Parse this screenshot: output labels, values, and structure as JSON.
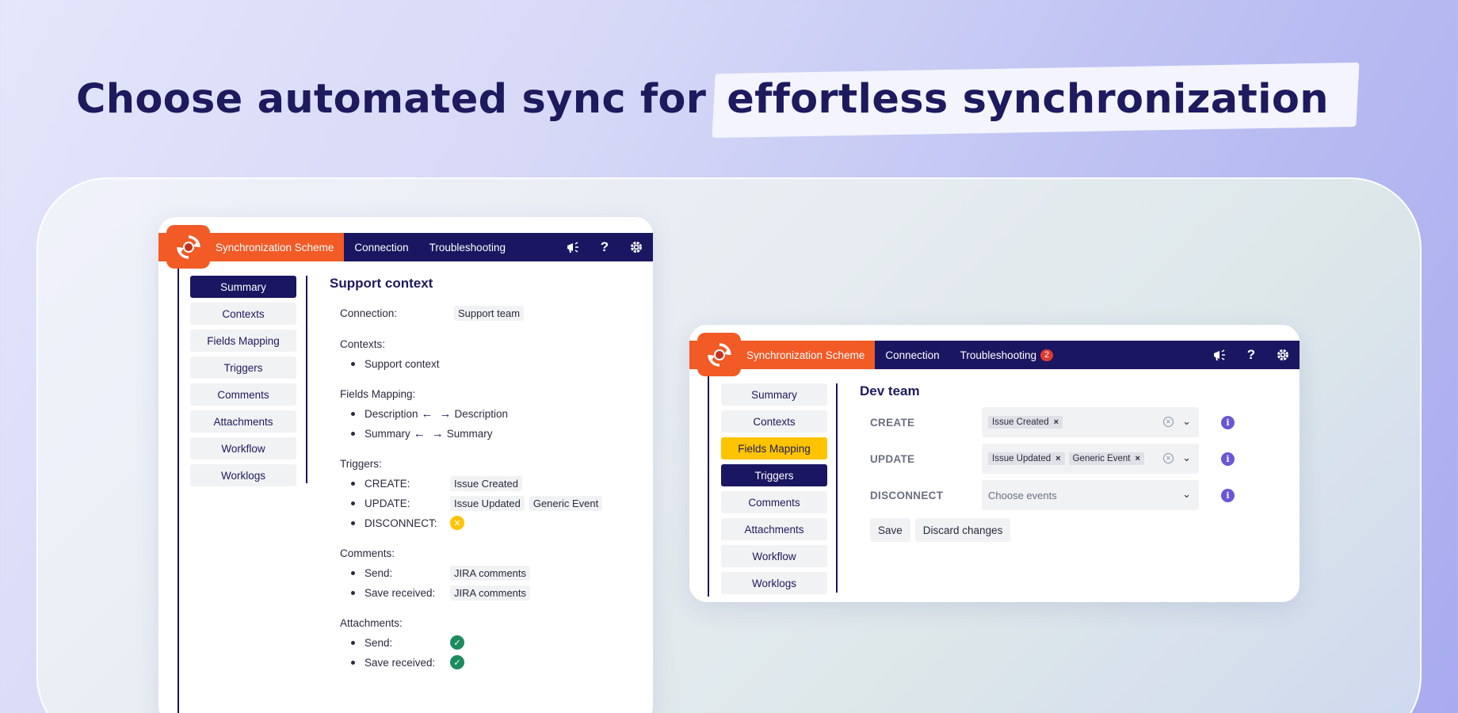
{
  "headline": {
    "plain": "Choose automated sync for",
    "highlight": "effortless synchronization"
  },
  "window1": {
    "nav": {
      "active_tab": "Synchronization Scheme",
      "tabs": [
        "Connection",
        "Troubleshooting"
      ]
    },
    "menu": [
      "Summary",
      "Contexts",
      "Fields Mapping",
      "Triggers",
      "Comments",
      "Attachments",
      "Workflow",
      "Worklogs"
    ],
    "active_menu": "Summary",
    "title": "Support context",
    "connection": {
      "label": "Connection:",
      "value": "Support team"
    },
    "contexts": {
      "label": "Contexts:",
      "items": [
        "Support context"
      ]
    },
    "fields_mapping": {
      "label": "Fields Mapping:",
      "items": [
        {
          "from": "Description",
          "to": "Description"
        },
        {
          "from": "Summary",
          "to": "Summary"
        }
      ]
    },
    "triggers": {
      "label": "Triggers:",
      "create": {
        "label": "CREATE:",
        "values": [
          "Issue Created"
        ]
      },
      "update": {
        "label": "UPDATE:",
        "values": [
          "Issue Updated",
          "Generic Event"
        ]
      },
      "disconnect": {
        "label": "DISCONNECT:"
      }
    },
    "comments": {
      "label": "Comments:",
      "send": {
        "label": "Send:",
        "value": "JIRA comments"
      },
      "save": {
        "label": "Save received:",
        "value": "JIRA comments"
      }
    },
    "attachments": {
      "label": "Attachments:",
      "send": {
        "label": "Send:"
      },
      "save": {
        "label": "Save received:"
      }
    }
  },
  "window2": {
    "nav": {
      "active_tab": "Synchronization Scheme",
      "tabs": [
        "Connection",
        "Troubleshooting"
      ],
      "troubleshooting_badge": "2"
    },
    "menu": [
      "Summary",
      "Contexts",
      "Fields Mapping",
      "Triggers",
      "Comments",
      "Attachments",
      "Workflow",
      "Worklogs"
    ],
    "title": "Dev team",
    "create": {
      "label": "CREATE",
      "tags": [
        "Issue Created"
      ]
    },
    "update": {
      "label": "UPDATE",
      "tags": [
        "Issue Updated",
        "Generic Event"
      ]
    },
    "disconnect": {
      "label": "DISCONNECT",
      "placeholder": "Choose events"
    },
    "save_label": "Save",
    "discard_label": "Discard changes"
  },
  "colors": {
    "navy": "#1a1661",
    "orange": "#f25a26",
    "yellow": "#ffc400",
    "green": "#1c8c5e",
    "purple": "#6b56d6"
  }
}
